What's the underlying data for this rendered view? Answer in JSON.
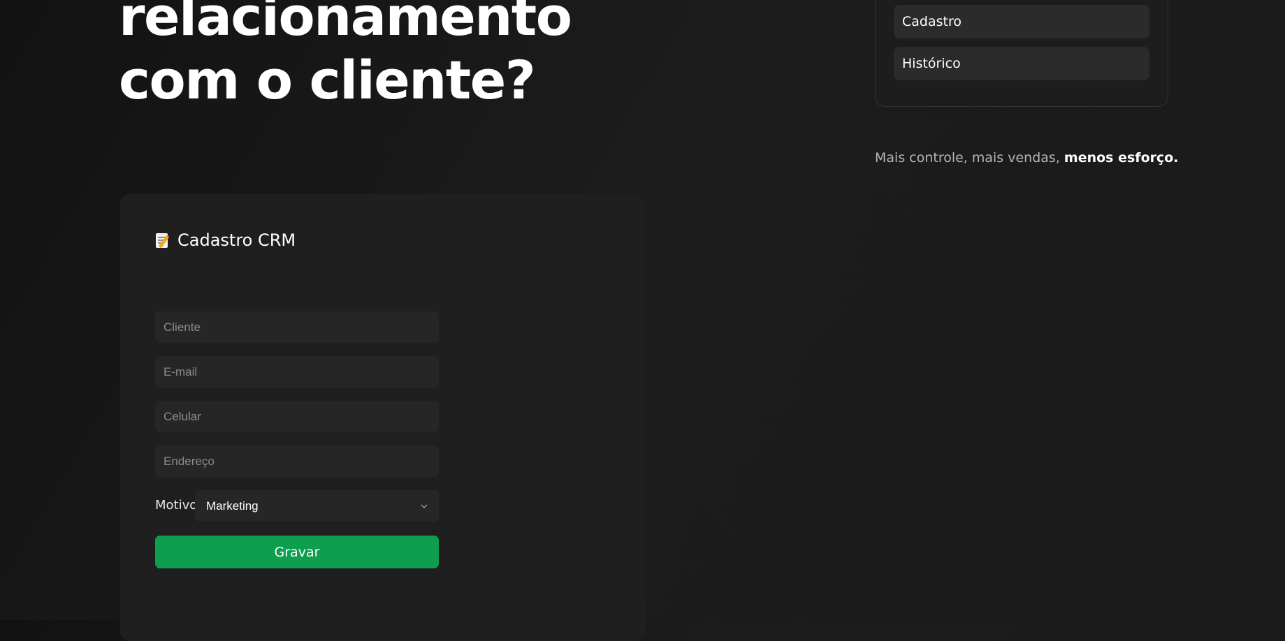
{
  "hero": {
    "title_line_1": "relacionamento",
    "title_line_2": "com o cliente?"
  },
  "nav": {
    "items": [
      {
        "label": "Cadastro"
      },
      {
        "label": "Histórico"
      }
    ]
  },
  "tagline": {
    "regular": "Mais controle, mais vendas, ",
    "emphasis": "menos esforço."
  },
  "form": {
    "icon": "memo-icon",
    "title": "Cadastro CRM",
    "fields": {
      "cliente": {
        "placeholder": "Cliente",
        "value": ""
      },
      "email": {
        "placeholder": "E-mail",
        "value": ""
      },
      "celular": {
        "placeholder": "Celular",
        "value": ""
      },
      "endereco": {
        "placeholder": "Endereço",
        "value": ""
      }
    },
    "motivo": {
      "label": "Motivo",
      "selected": "Marketing"
    },
    "submit_label": "Gravar"
  },
  "colors": {
    "background": "#161616",
    "card": "#1f1f1f",
    "input": "#262626",
    "accent_green": "#0f9d4f",
    "muted_text": "#b5b5b5"
  }
}
